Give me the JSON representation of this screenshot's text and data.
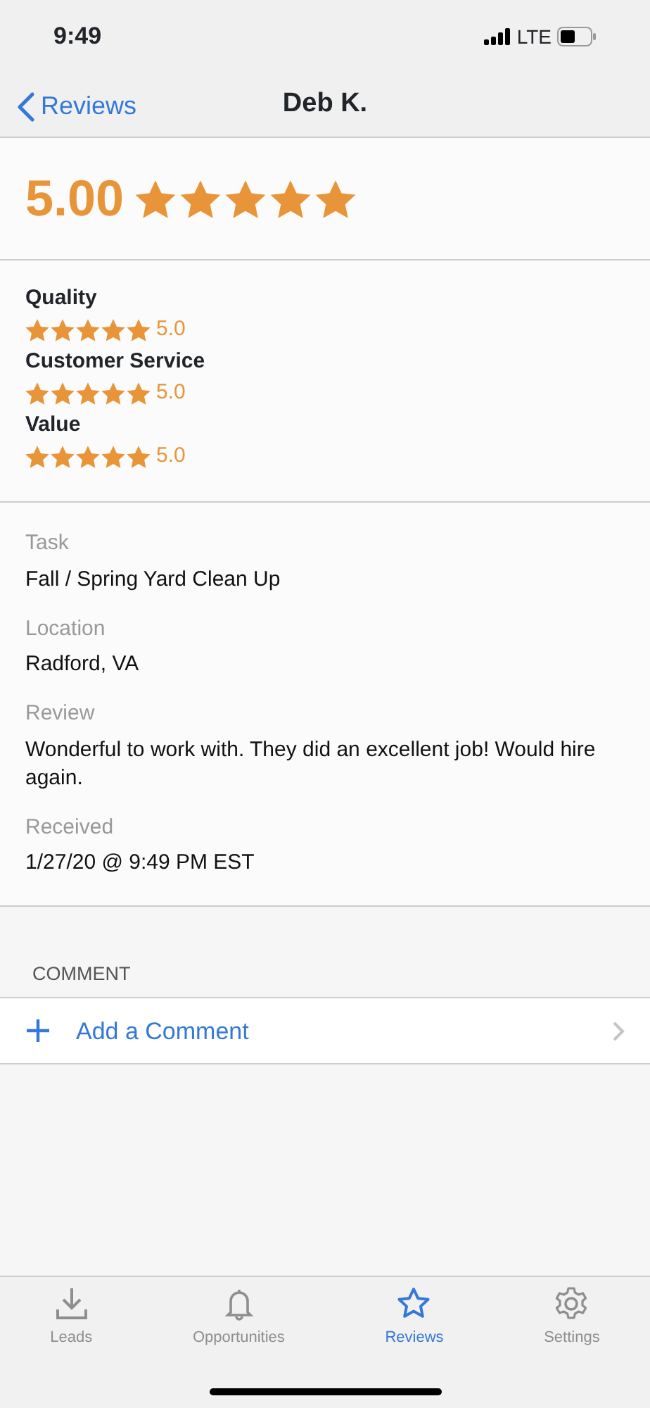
{
  "status_bar": {
    "time": "9:49",
    "network": "LTE"
  },
  "nav": {
    "back": "Reviews",
    "title": "Deb K."
  },
  "overall": {
    "score": "5.00",
    "stars": 5
  },
  "categories": [
    {
      "label": "Quality",
      "stars": 5,
      "score": "5.0"
    },
    {
      "label": "Customer Service",
      "stars": 5,
      "score": "5.0"
    },
    {
      "label": "Value",
      "stars": 5,
      "score": "5.0"
    }
  ],
  "details": [
    {
      "label": "Task",
      "value": "Fall / Spring Yard Clean Up"
    },
    {
      "label": "Location",
      "value": "Radford, VA"
    },
    {
      "label": "Review",
      "value": "Wonderful to work with. They did an excellent job! Would hire again."
    },
    {
      "label": "Received",
      "value": "1/27/20 @ 9:49 PM EST"
    }
  ],
  "comment": {
    "header": "COMMENT",
    "action": "Add a Comment"
  },
  "tabs": [
    {
      "label": "Leads",
      "kind": "download",
      "selected": false
    },
    {
      "label": "Opportunities",
      "kind": "bell",
      "selected": false
    },
    {
      "label": "Reviews",
      "kind": "star",
      "selected": true
    },
    {
      "label": "Settings",
      "kind": "gear",
      "selected": false
    }
  ]
}
